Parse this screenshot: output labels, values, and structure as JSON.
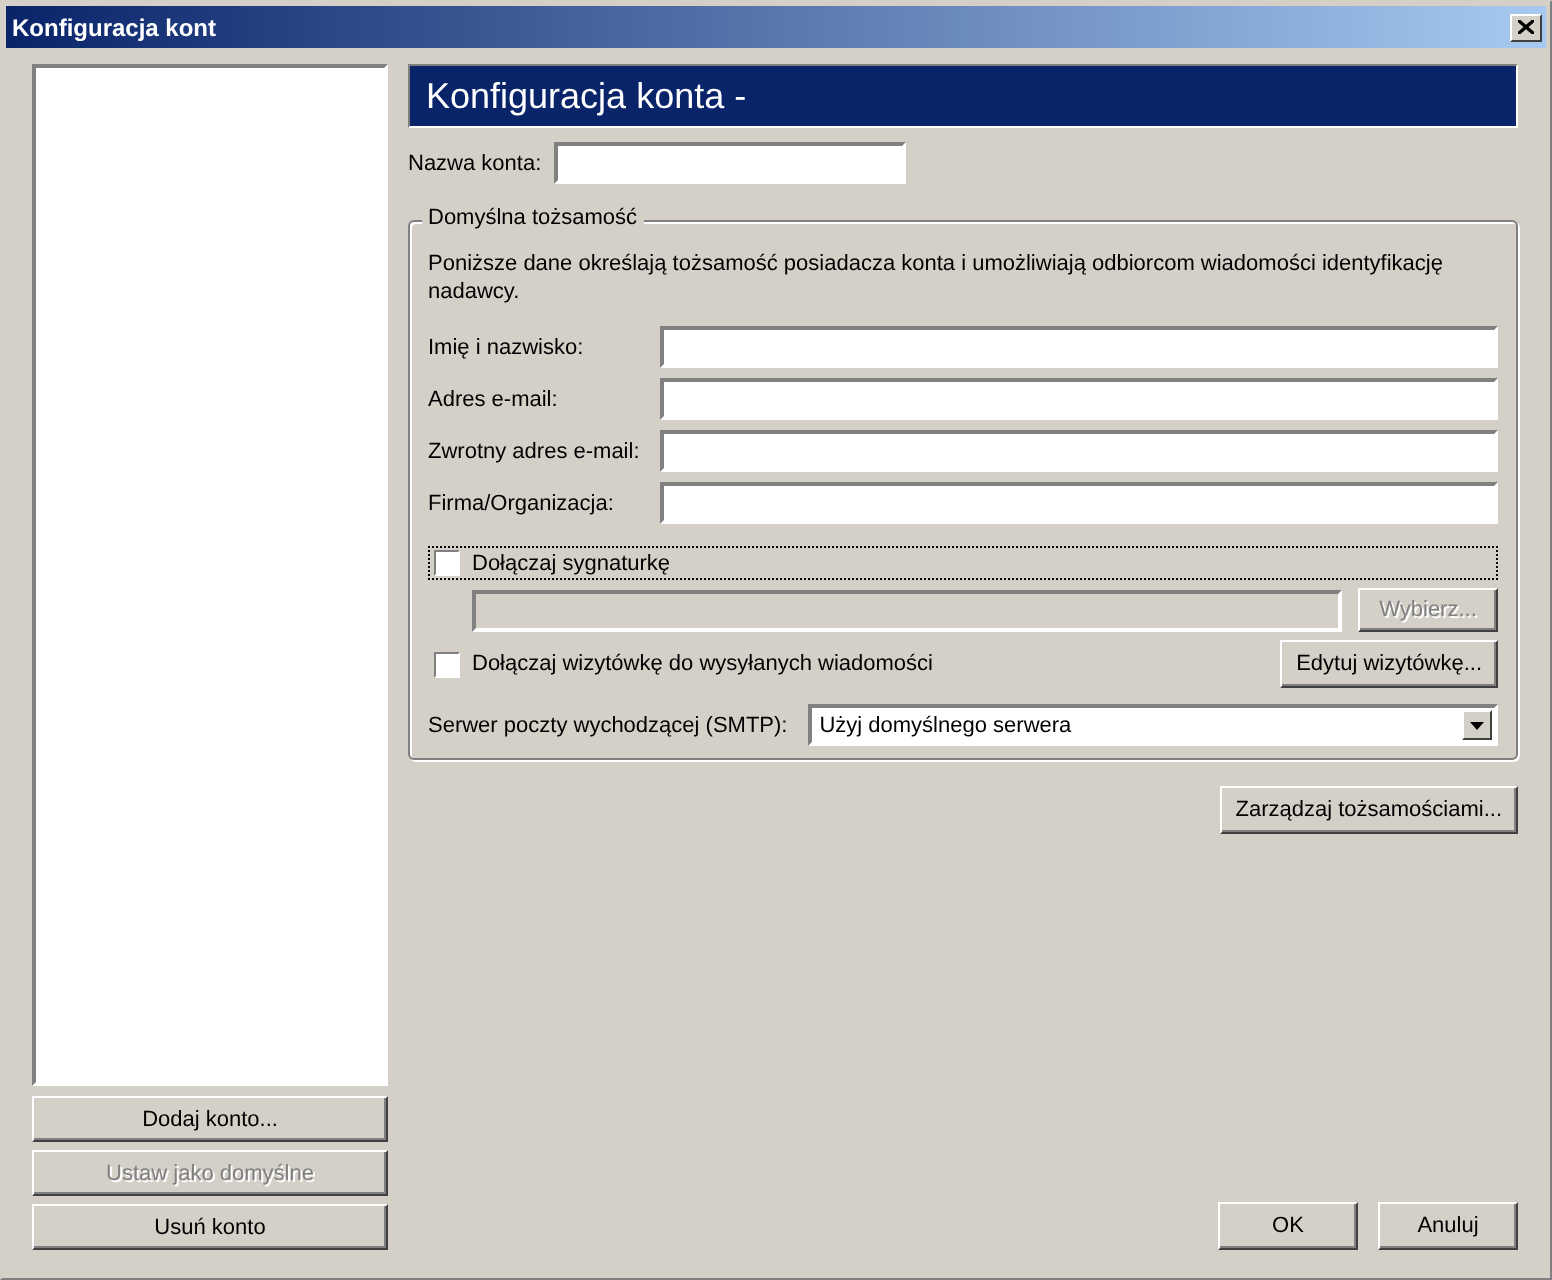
{
  "window": {
    "title": "Konfiguracja kont"
  },
  "account_buttons": [
    {
      "label": "Dodaj konto...",
      "disabled": false
    },
    {
      "label": "Ustaw jako domyślne",
      "disabled": true
    },
    {
      "label": "Usuń konto",
      "disabled": false
    }
  ],
  "panel": {
    "header": "Konfiguracja konta -",
    "account_name": {
      "label": "Nazwa konta:"
    }
  },
  "identity": {
    "legend": "Domyślna tożsamość",
    "description": "Poniższe dane określają tożsamość posiadacza konta i umożliwiają odbiorcom wiadomości identyfikację nadawcy.",
    "fields": [
      {
        "label": "Imię i nazwisko:"
      },
      {
        "label": "Adres e-mail:"
      },
      {
        "label": "Zwrotny adres e-mail:"
      },
      {
        "label": "Firma/Organizacja:"
      }
    ],
    "signature": {
      "label": "Dołączaj sygnaturkę",
      "checked": false,
      "focused": true
    },
    "signature_file": {
      "disabled": true
    },
    "browse_button": {
      "label": "Wybierz...",
      "disabled": true
    },
    "vcard": {
      "label": "Dołączaj wizytówkę do wysyłanych wiadomości",
      "checked": false,
      "focused": false
    },
    "edit_vcard_button": {
      "label": "Edytuj wizytówkę...",
      "disabled": false
    },
    "smtp": {
      "label": "Serwer poczty wychodzącej (SMTP):",
      "value": "Użyj domyślnego serwera"
    }
  },
  "manage_identities_button": {
    "label": "Zarządzaj tożsamościami...",
    "disabled": false
  },
  "dialog_buttons": [
    {
      "label": "OK",
      "disabled": false
    },
    {
      "label": "Anuluj",
      "disabled": false
    }
  ]
}
